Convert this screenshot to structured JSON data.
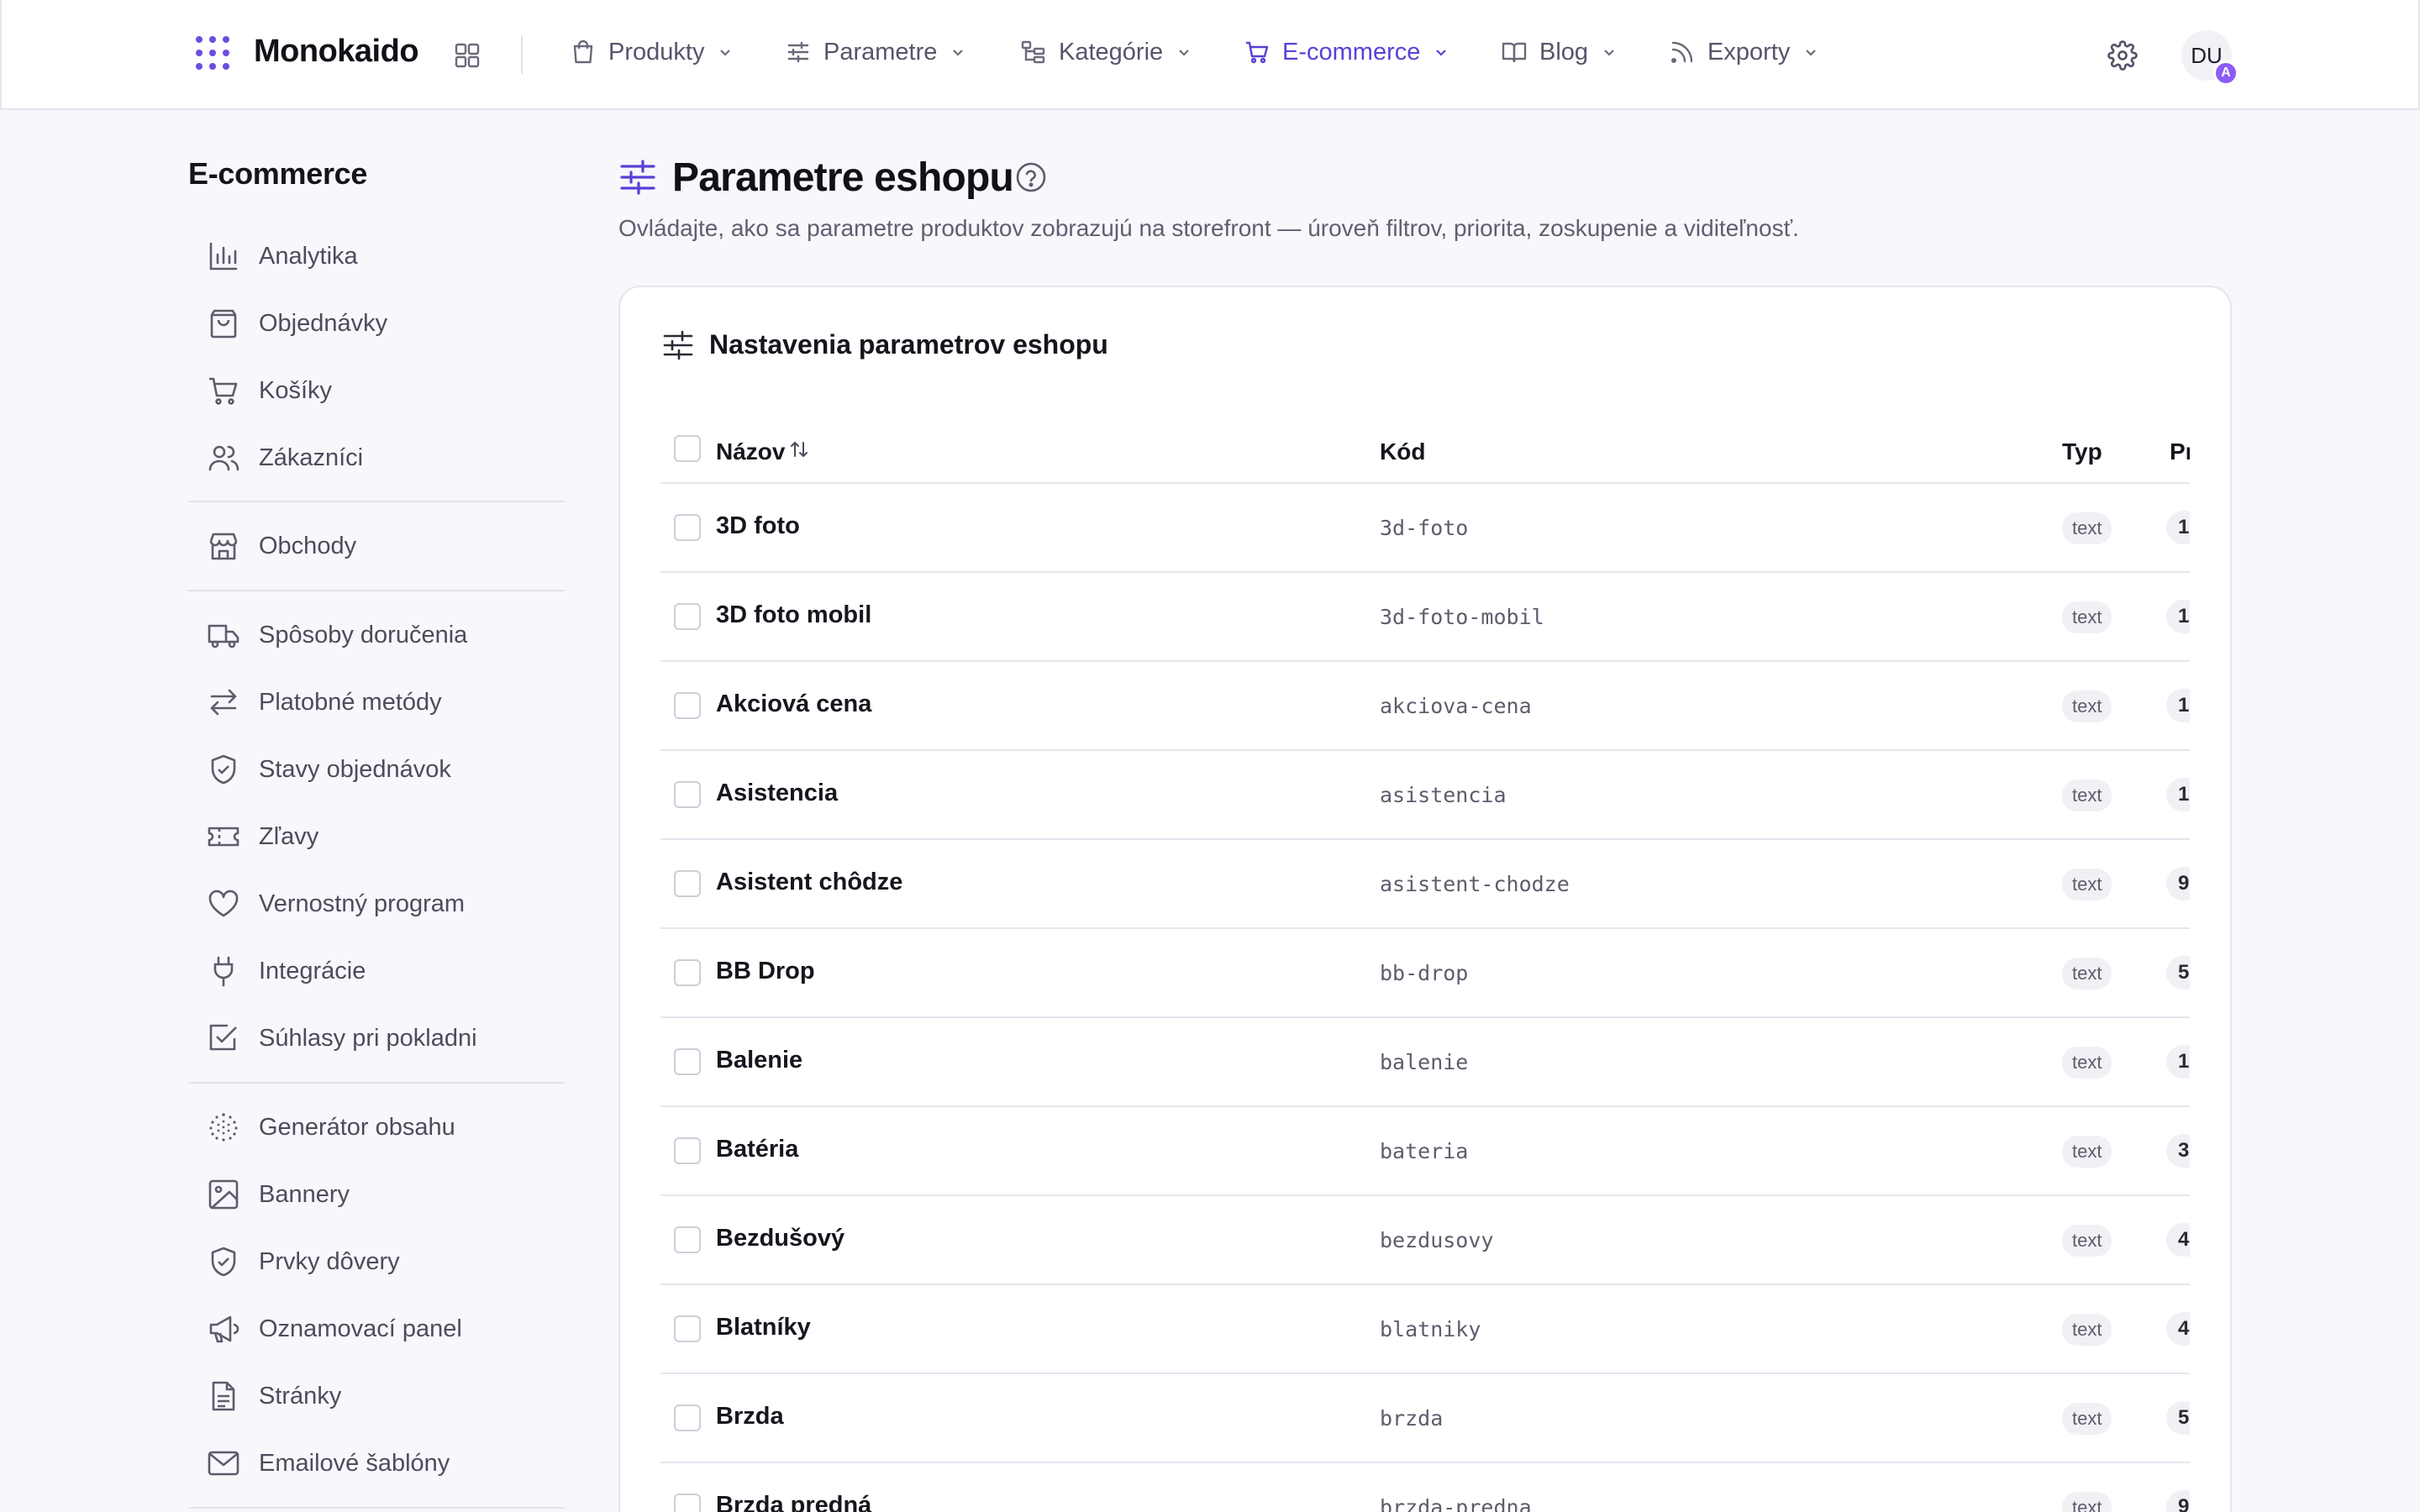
{
  "topbar": {
    "brand": "Monokaido",
    "nav": [
      {
        "label": "Produkty",
        "icon": "bag-icon"
      },
      {
        "label": "Parametre",
        "icon": "sliders-icon"
      },
      {
        "label": "Kategórie",
        "icon": "tree-icon"
      },
      {
        "label": "E-commerce",
        "icon": "cart-icon",
        "active": true
      },
      {
        "label": "Blog",
        "icon": "book-icon"
      },
      {
        "label": "Exporty",
        "icon": "rss-icon"
      }
    ],
    "avatar_initials": "DU",
    "avatar_badge": "A"
  },
  "sidebar": {
    "title": "E-commerce",
    "items": [
      {
        "label": "Analytika",
        "icon": "bar-chart-icon"
      },
      {
        "label": "Objednávky",
        "icon": "shopping-bag-icon"
      },
      {
        "label": "Košíky",
        "icon": "cart-icon"
      },
      {
        "label": "Zákazníci",
        "icon": "users-icon"
      },
      {
        "label": "Obchody",
        "icon": "store-icon"
      },
      {
        "label": "Spôsoby doručenia",
        "icon": "truck-icon"
      },
      {
        "label": "Platobné metódy",
        "icon": "arrows-icon"
      },
      {
        "label": "Stavy objednávok",
        "icon": "shield-check-icon"
      },
      {
        "label": "Zľavy",
        "icon": "ticket-icon"
      },
      {
        "label": "Vernostný program",
        "icon": "heart-icon"
      },
      {
        "label": "Integrácie",
        "icon": "plug-icon"
      },
      {
        "label": "Súhlasy pri pokladni",
        "icon": "checkbox-icon"
      },
      {
        "label": "Generátor obsahu",
        "icon": "sparkle-icon"
      },
      {
        "label": "Bannery",
        "icon": "image-icon"
      },
      {
        "label": "Prvky dôvery",
        "icon": "shield-check-icon"
      },
      {
        "label": "Oznamovací panel",
        "icon": "megaphone-icon"
      },
      {
        "label": "Stránky",
        "icon": "file-icon"
      },
      {
        "label": "Emailové šablóny",
        "icon": "mail-icon"
      }
    ]
  },
  "page": {
    "title": "Parametre eshopu",
    "subtitle": "Ovládajte, ako sa parametre produktov zobrazujú na storefront — úroveň filtrov, priorita, zoskupenie a viditeľnosť."
  },
  "card": {
    "title": "Nastavenia parametrov eshopu",
    "columns": {
      "name": "Názov",
      "code": "Kód",
      "type": "Typ",
      "priority": "Pr"
    },
    "rows": [
      {
        "name": "3D foto",
        "code": "3d-foto",
        "type": "text",
        "priority": "1"
      },
      {
        "name": "3D foto mobil",
        "code": "3d-foto-mobil",
        "type": "text",
        "priority": "1"
      },
      {
        "name": "Akciová cena",
        "code": "akciova-cena",
        "type": "text",
        "priority": "1"
      },
      {
        "name": "Asistencia",
        "code": "asistencia",
        "type": "text",
        "priority": "1"
      },
      {
        "name": "Asistent chôdze",
        "code": "asistent-chodze",
        "type": "text",
        "priority": "9"
      },
      {
        "name": "BB Drop",
        "code": "bb-drop",
        "type": "text",
        "priority": "5"
      },
      {
        "name": "Balenie",
        "code": "balenie",
        "type": "text",
        "priority": "1"
      },
      {
        "name": "Batéria",
        "code": "bateria",
        "type": "text",
        "priority": "3"
      },
      {
        "name": "Bezdušový",
        "code": "bezdusovy",
        "type": "text",
        "priority": "4"
      },
      {
        "name": "Blatníky",
        "code": "blatniky",
        "type": "text",
        "priority": "4"
      },
      {
        "name": "Brzda",
        "code": "brzda",
        "type": "text",
        "priority": "5"
      },
      {
        "name": "Brzda predná",
        "code": "brzda-predna",
        "type": "text",
        "priority": "9"
      }
    ]
  },
  "colors": {
    "accent": "#5b3fd6",
    "badge": "#8b5cf6",
    "background": "#f8f7fb"
  }
}
